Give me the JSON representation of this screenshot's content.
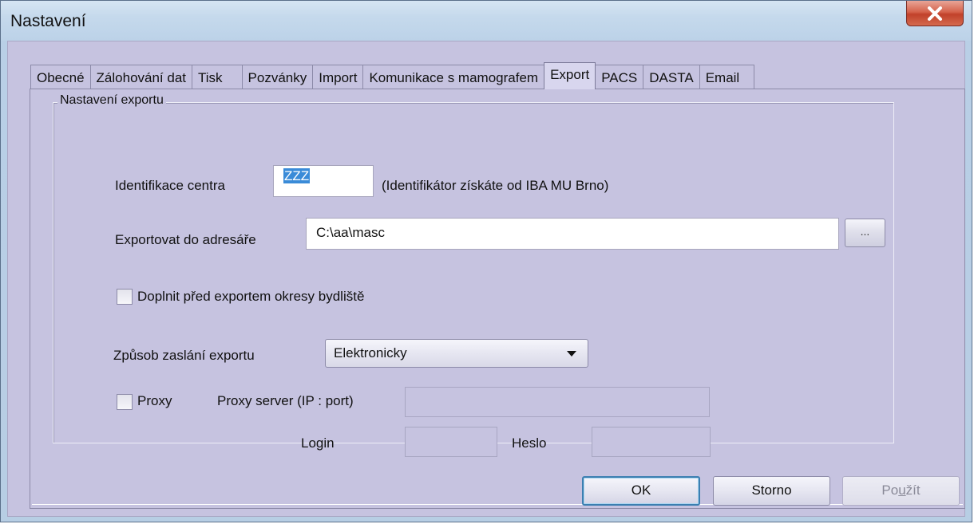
{
  "window": {
    "title": "Nastavení"
  },
  "tabs": [
    "Obecné",
    "Zálohování dat",
    "Tisk",
    "Pozvánky",
    "Import",
    "Komunikace s mamografem",
    "Export",
    "PACS",
    "DASTA",
    "Email"
  ],
  "active_tab": "Export",
  "group": {
    "label": "Nastavení exportu",
    "center_id": {
      "label": "Identifikace centra",
      "value": "ZZZ",
      "hint": "(Identifikátor získáte od IBA MU Brno)"
    },
    "export_dir": {
      "label": "Exportovat do adresáře",
      "value": "C:\\aa\\masc",
      "browse_label": "..."
    },
    "fill_districts": {
      "label": "Doplnit před exportem okresy bydliště",
      "checked": false
    },
    "send_method": {
      "label": "Způsob zaslání exportu",
      "value": "Elektronicky"
    },
    "proxy": {
      "label": "Proxy",
      "checked": false,
      "server_label": "Proxy server (IP : port)",
      "server_value": "",
      "login_label": "Login",
      "login_value": "",
      "password_label": "Heslo",
      "password_value": ""
    }
  },
  "buttons": {
    "ok": "OK",
    "cancel": "Storno",
    "apply_pre": "Po",
    "apply_u": "u",
    "apply_post": "žít"
  }
}
